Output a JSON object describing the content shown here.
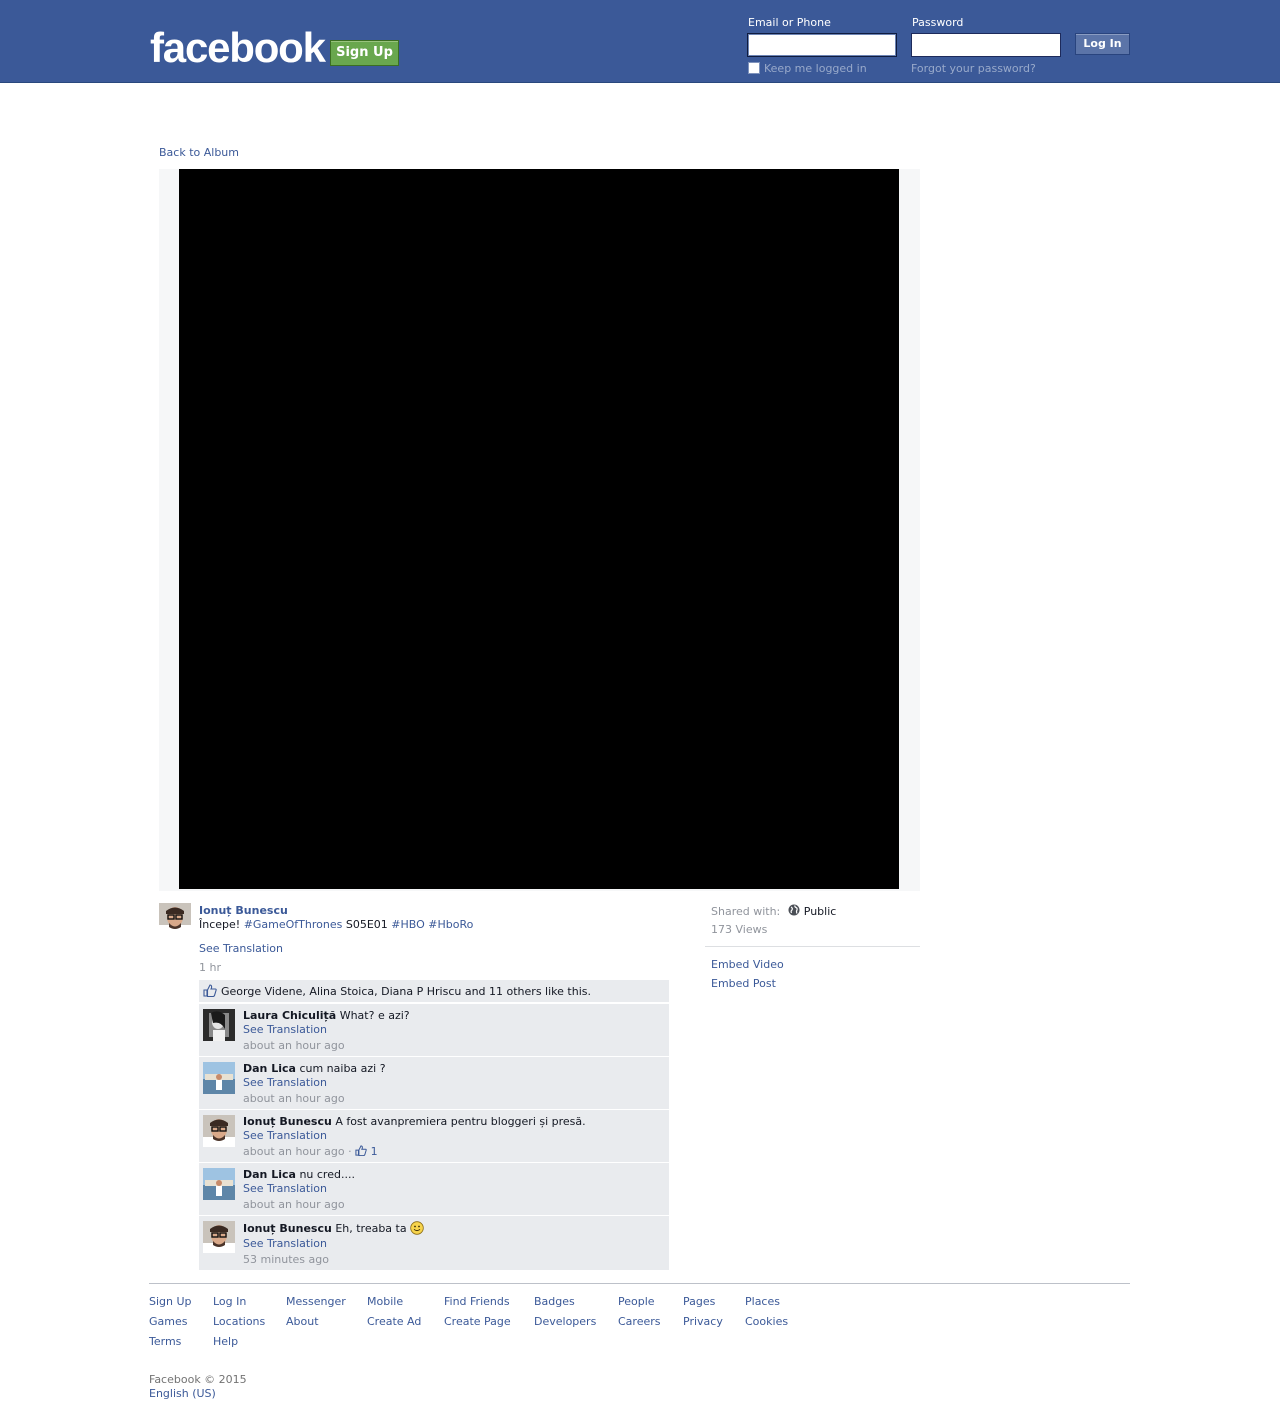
{
  "header": {
    "logo": "facebook",
    "signup_label": "Sign Up",
    "email_label": "Email or Phone",
    "password_label": "Password",
    "email_value": "",
    "password_value": "",
    "login_label": "Log In",
    "keep_logged_in": "Keep me logged in",
    "forgot_password": "Forgot your password?"
  },
  "nav": {
    "back_to_album": "Back to Album"
  },
  "post": {
    "author": "Ionuț Bunescu",
    "text_prefix": "Începe! ",
    "tag_game_of_thrones": "#GameOfThrones",
    "text_episode": " S05E01 ",
    "tag_hbo": "#HBO",
    "tag_hboro": "#HboRo",
    "see_translation": "See Translation",
    "time": "1 hr",
    "likes_text": "George Videne, Alina Stoica, Diana P Hriscu and 11 others like this."
  },
  "comments": [
    {
      "name": "Laura Chiculiță",
      "text": "What? e azi?",
      "translation": "See Translation",
      "time": "about an hour ago",
      "likes": ""
    },
    {
      "name": "Dan Lica",
      "text": "cum naiba azi ?",
      "translation": "See Translation",
      "time": "about an hour ago",
      "likes": ""
    },
    {
      "name": "Ionuț Bunescu",
      "text": "A fost avanpremiera pentru bloggeri și presă.",
      "translation": "See Translation",
      "time": "about an hour ago",
      "likes": "1"
    },
    {
      "name": "Dan Lica",
      "text": "nu cred....",
      "translation": "See Translation",
      "time": "about an hour ago",
      "likes": ""
    },
    {
      "name": "Ionuț Bunescu",
      "text": "Eh, treaba ta",
      "translation": "See Translation",
      "time": "53 minutes ago",
      "likes": ""
    }
  ],
  "sidebar": {
    "shared_with_label": "Shared with:",
    "privacy": "Public",
    "views": "173 Views",
    "embed_video": "Embed Video",
    "embed_post": "Embed Post"
  },
  "footer": {
    "links": {
      "sign_up": "Sign Up",
      "log_in": "Log In",
      "messenger": "Messenger",
      "mobile": "Mobile",
      "find_friends": "Find Friends",
      "badges": "Badges",
      "people": "People",
      "pages": "Pages",
      "places": "Places",
      "games": "Games",
      "locations": "Locations",
      "about": "About",
      "create_ad": "Create Ad",
      "create_page": "Create Page",
      "developers": "Developers",
      "careers": "Careers",
      "privacy": "Privacy",
      "cookies": "Cookies",
      "terms": "Terms",
      "help": "Help"
    },
    "copyright": "Facebook © 2015",
    "language": "English (US)"
  },
  "colors": {
    "brand_blue": "#3b5998",
    "signup_green": "#69a74e",
    "comment_bg": "#e9ebee",
    "video_bg": "#000000"
  },
  "icons": {
    "like": "thumbs-up-icon",
    "globe": "globe-icon",
    "smiley": "smiley-icon"
  }
}
